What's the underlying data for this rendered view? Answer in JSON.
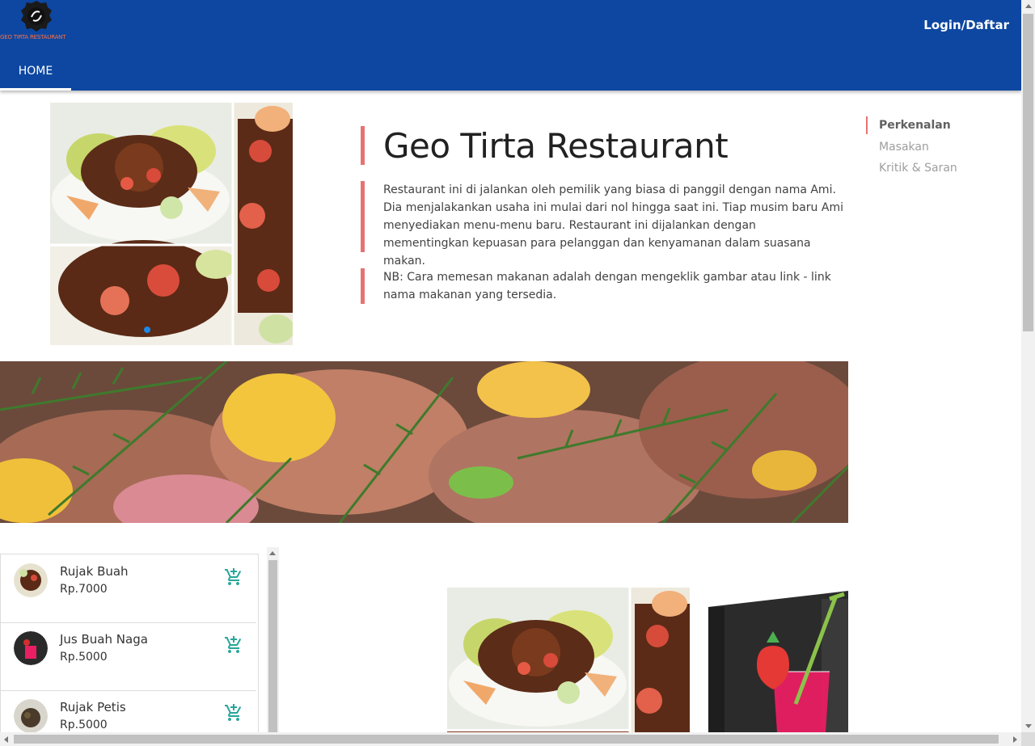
{
  "brand": {
    "name": "GEO TIRTA RESTAURANT"
  },
  "header": {
    "login_label": "Login/Daftar"
  },
  "nav": {
    "tabs": [
      {
        "label": "HOME"
      }
    ]
  },
  "intro": {
    "title": "Geo Tirta Restaurant",
    "paragraph": "Restaurant ini di jalankan oleh pemilik yang biasa di panggil dengan nama Ami. Dia menjalakankan usaha ini mulai dari nol hingga saat ini. Tiap musim baru Ami menyediakan menu-menu baru. Restaurant ini dijalankan dengan mementingkan kepuasan para pelanggan dan kenyamanan dalam suasana makan.",
    "note": "NB: Cara memesan makanan adalah dengan mengeklik gambar atau link - link nama makanan yang tersedia."
  },
  "scrollspy": {
    "items": [
      {
        "label": "Perkenalan",
        "active": true
      },
      {
        "label": "Masakan",
        "active": false
      },
      {
        "label": "Kritik & Saran",
        "active": false
      }
    ]
  },
  "menu": {
    "items": [
      {
        "name": "Rujak Buah",
        "price": "Rp.7000",
        "icon": "add-shopping-cart-icon"
      },
      {
        "name": "Jus Buah Naga",
        "price": "Rp.5000",
        "icon": "add-shopping-cart-icon"
      },
      {
        "name": "Rujak Petis",
        "price": "Rp.5000",
        "icon": "add-shopping-cart-icon"
      }
    ]
  },
  "colors": {
    "header": "#0d47a1",
    "accent": "#e57373",
    "cart": "#26a69a"
  }
}
